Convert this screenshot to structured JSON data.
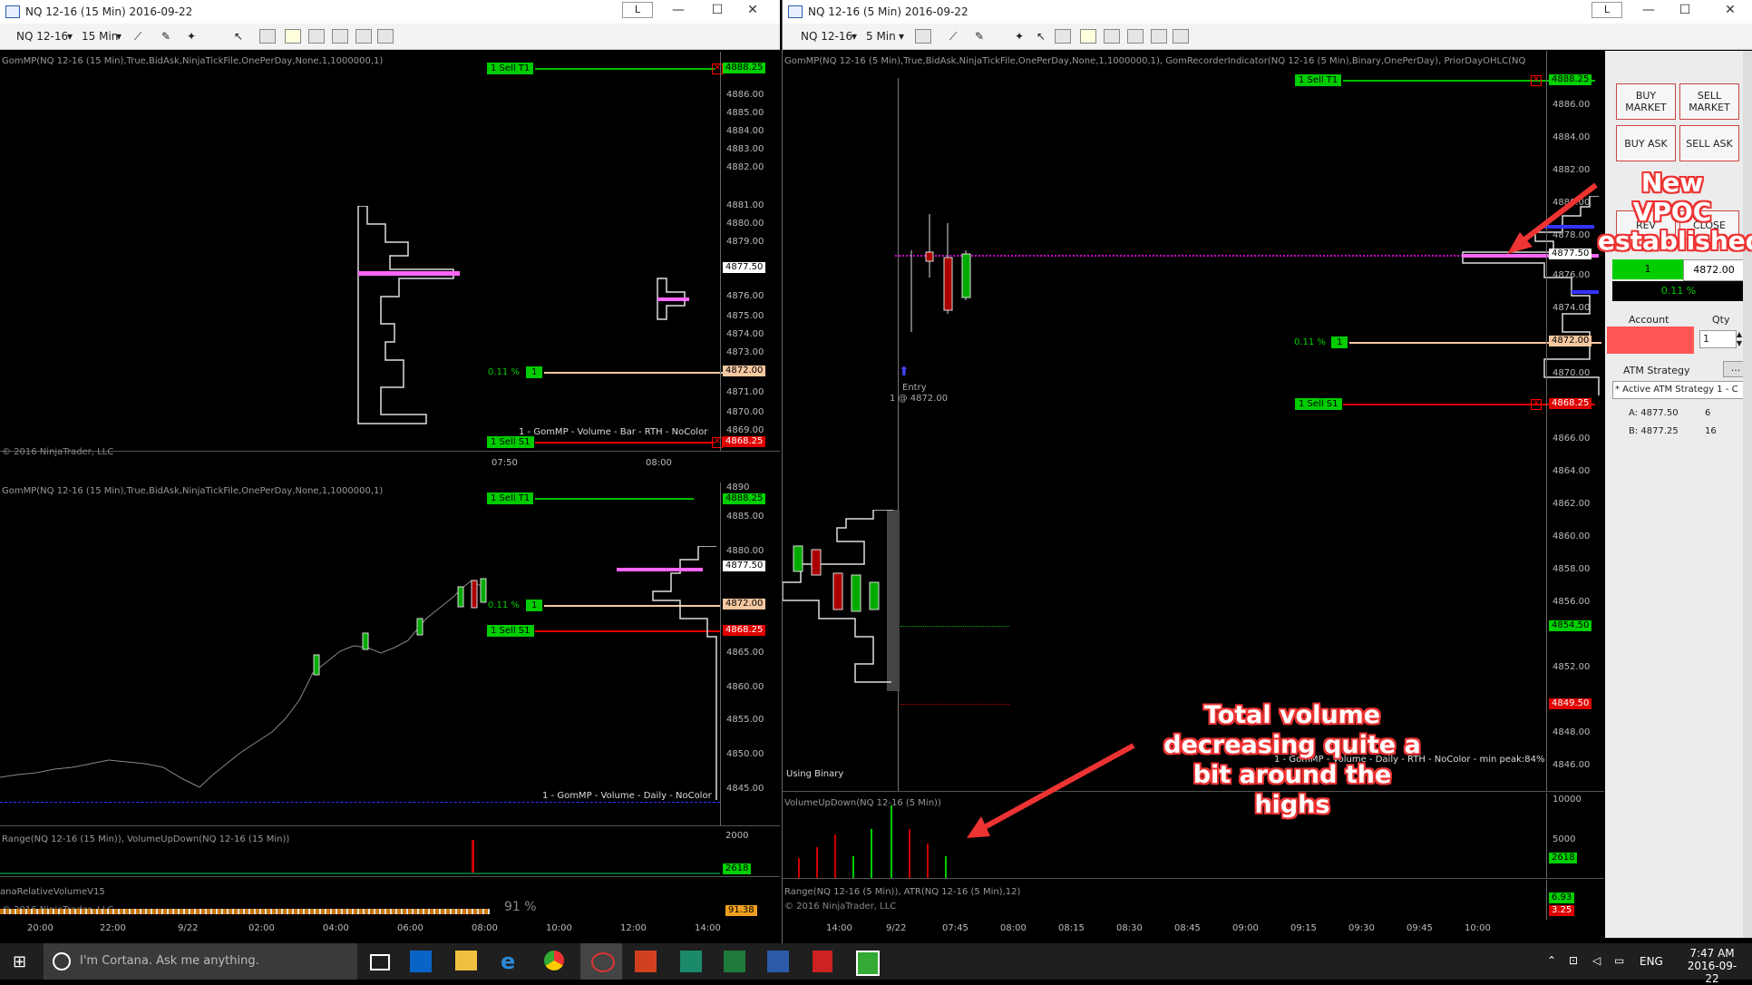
{
  "left_window": {
    "title": "NQ 12-16 (15 Min)  2016-09-22",
    "link_label": "L",
    "instrument": "NQ 12-16",
    "interval": "15 Min",
    "top_panel": {
      "indicator_label": "GomMP(NQ 12-16 (15 Min),True,BidAsk,NinjaTickFile,OnePerDay,None,1,1000000,1)",
      "footer_label": "1 - GomMP - Volume - Bar - RTH - NoColor",
      "copyright": "© 2016 NinjaTrader, LLC",
      "price_ticks": [
        "4886.00",
        "4885.00",
        "4884.00",
        "4883.00",
        "4882.00",
        "4881.00",
        "4880.00",
        "4879.00",
        "4877.50",
        "4876.00",
        "4875.00",
        "4874.00",
        "4873.00",
        "4871.00",
        "4870.00",
        "4869.00"
      ],
      "time_ticks": [
        "07:50",
        "08:00"
      ]
    },
    "bottom_panel": {
      "indicator_label": "GomMP(NQ 12-16 (15 Min),True,BidAsk,NinjaTickFile,OnePerDay,None,1,1000000,1)",
      "footer_label": "1 - GomMP - Volume - Daily - NoColor",
      "price_ticks": [
        "4890",
        "4885.00",
        "4880.00",
        "4875.00",
        "4870.00",
        "4865.00",
        "4860.00",
        "4855.00",
        "4850.00",
        "4845.00"
      ],
      "range_label": "Range(NQ 12-16 (15 Min)), VolumeUpDown(NQ 12-16 (15 Min))",
      "range_tick": "2000",
      "range_value": "2618",
      "rv_label": "anaRelativeVolumeV15",
      "rv_copyright": "© 2016 NinjaTrader, LLC",
      "rv_pct": "91 %",
      "rv_value": "91.38",
      "time_ticks": [
        "20:00",
        "22:00",
        "9/22",
        "02:00",
        "04:00",
        "06:00",
        "08:00",
        "10:00",
        "12:00",
        "14:00"
      ]
    },
    "pct_label": "0.11 %"
  },
  "right_window": {
    "title": "NQ 12-16 (5 Min)  2016-09-22",
    "link_label": "L",
    "instrument": "NQ 12-16",
    "interval": "5 Min",
    "indicator_label": "GomMP(NQ 12-16 (5 Min),True,BidAsk,NinjaTickFile,OnePerDay,None,1,1000000,1), GomRecorderIndicator(NQ 12-16 (5 Min),Binary,OnePerDay), PriorDayOHLC(NQ",
    "price_ticks": [
      "4886.00",
      "4884.00",
      "4882.00",
      "4880.00",
      "4878.00",
      "4876.00",
      "4874.00",
      "4872.00",
      "4870.00",
      "4868.00",
      "4866.00",
      "4864.00",
      "4862.00",
      "4860.00",
      "4858.00",
      "4856.00",
      "4854.00",
      "4852.00",
      "4850.00",
      "4848.00",
      "4846.00"
    ],
    "entry_label": "Entry",
    "entry_price": "1 @ 4872.00",
    "using_binary": "Using Binary",
    "footer_label": "1 - GomMP - Volume - Daily - RTH - NoColor - min peak:84%",
    "vol_label": "VolumeUpDown(NQ 12-16 (5 Min))",
    "vol_ticks": [
      "10000",
      "5000"
    ],
    "vol_value": "2618",
    "atr_label": "Range(NQ 12-16 (5 Min)), ATR(NQ 12-16 (5 Min),12)",
    "atr_copyright": "© 2016 NinjaTrader, LLC",
    "atr_values": [
      "6.93",
      "3.25"
    ],
    "time_ticks": [
      "14:00",
      "9/22",
      "07:45",
      "08:00",
      "08:15",
      "08:30",
      "08:45",
      "09:00",
      "09:15",
      "09:30",
      "09:45",
      "10:00"
    ],
    "pct_label": "0.11 %"
  },
  "price_tags": {
    "target": "4888.25",
    "vpoc": "4877.50",
    "entry": "4872.00",
    "stop": "4868.25",
    "level_4854": "4854.50",
    "level_4849": "4849.50"
  },
  "orders": {
    "target": "1  Sell T1",
    "stop": "1  Sell S1",
    "qty": "1"
  },
  "order_panel": {
    "buy_market": "BUY MARKET",
    "sell_market": "SELL MARKET",
    "buy_ask": "BUY ASK",
    "sell_ask": "SELL ASK",
    "rev": "REV",
    "close": "CLOSE",
    "position_qty": "1",
    "position_price": "4872.00",
    "pnl": "0.11 %",
    "account_label": "Account",
    "qty_label": "Qty",
    "qty_value": "1",
    "atm_label": "ATM Strategy",
    "atm_btn": "...",
    "atm_value": "* Active ATM Strategy 1 - C",
    "ask_label": "A: 4877.50",
    "ask_size": "6",
    "bid_label": "B: 4877.25",
    "bid_size": "16"
  },
  "annotations": {
    "vpoc": "New VPOC established",
    "volume": "Total volume decreasing quite a bit around the highs"
  },
  "taskbar": {
    "search": "I'm Cortana. Ask me anything.",
    "lang": "ENG",
    "time": "7:47 AM",
    "date": "2016-09-22"
  },
  "colors": {
    "buy": "#00c000",
    "sell": "#e00000",
    "vpoc": "#ff66ff",
    "entry": "#f5c8a0"
  }
}
